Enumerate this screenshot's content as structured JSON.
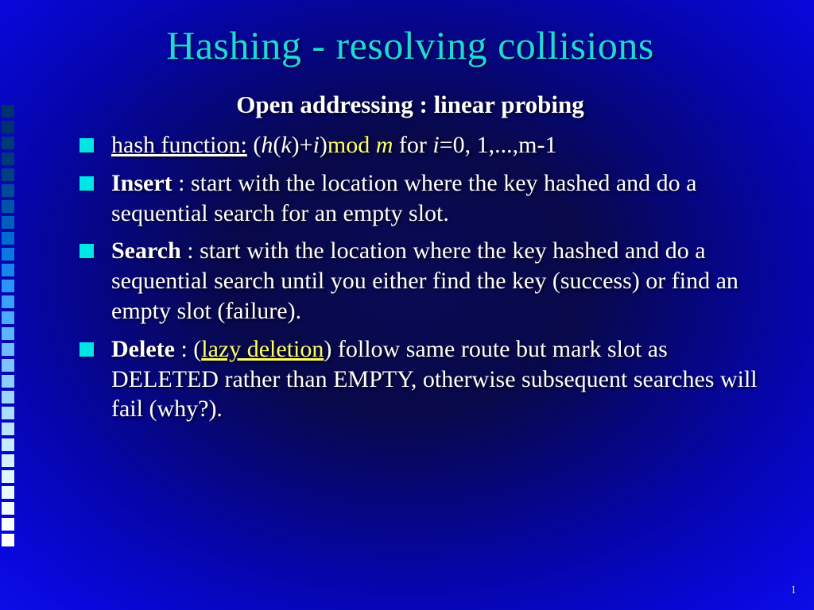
{
  "title": "Hashing - resolving collisions",
  "subtitle": "Open addressing : linear probing",
  "bullets": {
    "b1": {
      "hash_function_label": "hash function:",
      "paren_open": " (",
      "h": "h",
      "p1": "(",
      "k": "k",
      "p2": ")",
      "plus": "+",
      "i": "i",
      "p3": ")",
      "mod": "mod ",
      "m": "m",
      "rest": " for ",
      "ieq": "i",
      "tail": "=0, 1,...,m-1"
    },
    "b2": {
      "lead": "Insert",
      "rest": " : start with the location where the key hashed and do a sequential search for an empty slot."
    },
    "b3": {
      "lead": "Search",
      "rest": " : start with the location where the key hashed and do a sequential search until you either find the key (success) or find an empty slot (failure)."
    },
    "b4": {
      "lead": "Delete",
      "colon": " : (",
      "lazy": "lazy deletion",
      "post": ") follow same route but mark slot as ",
      "deleted": "DELETED",
      "mid": " rather than ",
      "empty": "EMPTY",
      "end": ", otherwise subsequent searches will fail (why?)."
    }
  },
  "page_number": "1",
  "deco_colors": [
    "#003070",
    "#003070",
    "#003878",
    "#003878",
    "#003f84",
    "#004a98",
    "#0054a8",
    "#0060bc",
    "#006cce",
    "#0b78e2",
    "#1a84ee",
    "#2c94f6",
    "#3ca0fa",
    "#4caaff",
    "#5cb4ff",
    "#6cbcff",
    "#7cc4ff",
    "#8cceff",
    "#9cd6ff",
    "#aaddff",
    "#b8e4ff",
    "#c6eaff",
    "#d2f0ff",
    "#def6ff",
    "#e8faff",
    "#f0fcff",
    "#f8feff",
    "#ffffff"
  ]
}
